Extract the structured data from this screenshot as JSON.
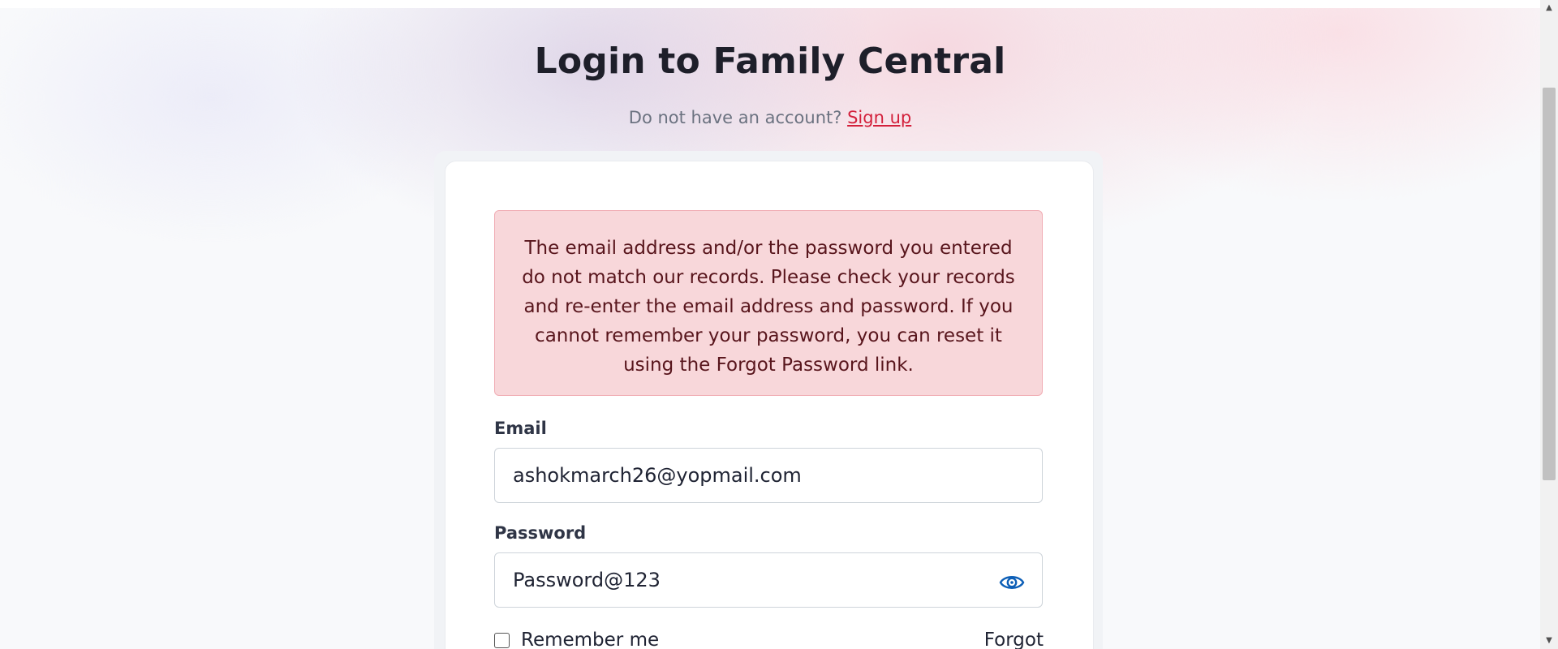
{
  "page": {
    "title": "Login to Family Central",
    "signup_prompt": "Do not have an account?",
    "signup_link": "Sign up"
  },
  "alert": {
    "message": "The email address and/or the password you entered do not match our records. Please check your records and re-enter the email address and password. If you cannot remember your password, you can reset it using the Forgot Password link."
  },
  "form": {
    "email_label": "Email",
    "email_value": "ashokmarch26@yopmail.com",
    "password_label": "Password",
    "password_value": "Password@123",
    "remember_label": "Remember me",
    "remember_checked": false,
    "forgot_link": "Forgot Password?"
  },
  "icons": {
    "password_toggle": "eye-icon"
  },
  "colors": {
    "link": "#d3203b",
    "alert_bg": "#f8d7da",
    "alert_text": "#58151c",
    "eye_icon": "#0d5fb7"
  }
}
